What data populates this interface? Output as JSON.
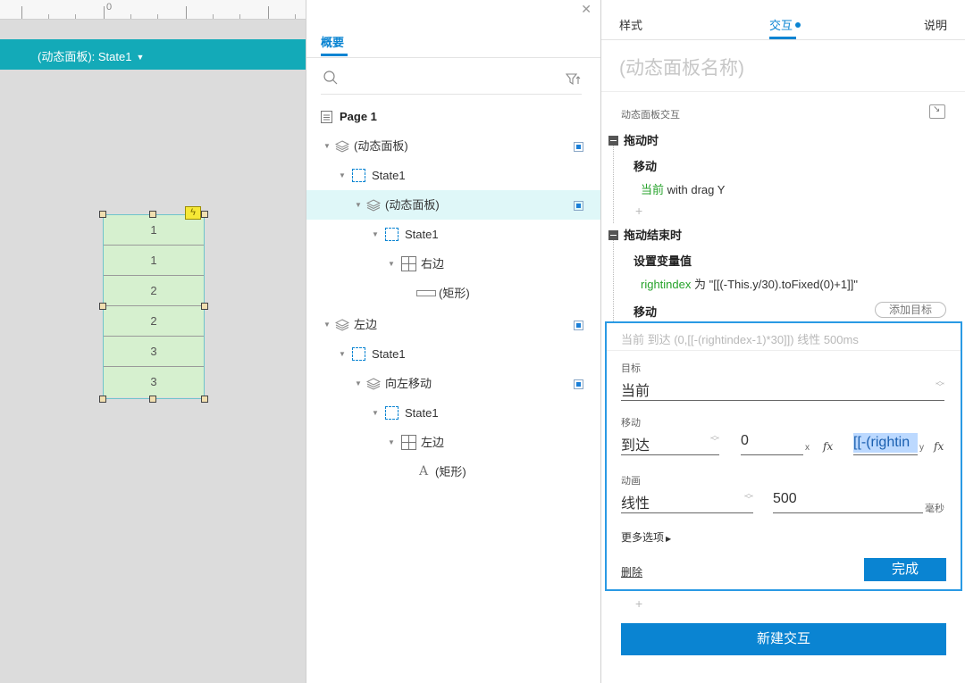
{
  "canvas": {
    "ruler_zero": "0",
    "state_bar": "(动态面板): State1",
    "rows": [
      "1",
      "1",
      "2",
      "2",
      "3",
      "3"
    ]
  },
  "outline": {
    "tab": "概要",
    "tree": [
      {
        "label": "Page 1",
        "icon": "page-icon",
        "sel": false,
        "vis": false
      },
      {
        "label": "(动态面板)",
        "icon": "layers-icon",
        "sel": false,
        "vis": true
      },
      {
        "label": "State1",
        "icon": "state-icon",
        "sel": false,
        "vis": false
      },
      {
        "label": "(动态面板)",
        "icon": "layers-icon",
        "sel": true,
        "vis": true
      },
      {
        "label": "State1",
        "icon": "state-icon",
        "sel": false,
        "vis": false
      },
      {
        "label": "右边",
        "icon": "repeater-icon",
        "sel": false,
        "vis": false
      },
      {
        "label": "(矩形)",
        "icon": "rectangle-icon",
        "sel": false,
        "vis": false
      },
      {
        "label": "左边",
        "icon": "layers-icon",
        "sel": false,
        "vis": true
      },
      {
        "label": "State1",
        "icon": "state-icon",
        "sel": false,
        "vis": false
      },
      {
        "label": "向左移动",
        "icon": "layers-icon",
        "sel": false,
        "vis": true
      },
      {
        "label": "State1",
        "icon": "state-icon",
        "sel": false,
        "vis": false
      },
      {
        "label": "左边",
        "icon": "repeater-icon",
        "sel": false,
        "vis": false
      },
      {
        "label": "(矩形)",
        "icon": "text-icon",
        "sel": false,
        "vis": false
      }
    ]
  },
  "inspector": {
    "tabs": {
      "style": "样式",
      "interaction": "交互",
      "notes": "说明"
    },
    "widget_name": "(动态面板名称)",
    "section_title": "动态面板交互",
    "event1": {
      "name": "拖动时",
      "action": "移动",
      "target_prefix": "当前",
      "target_rest": " with drag Y"
    },
    "add_plus": "+",
    "event2": {
      "name": "拖动结束时",
      "action1": "设置变量值",
      "var_name": "rightindex",
      "var_rest": " 为 \"[[(-This.y/30).toFixed(0)+1]]\"",
      "action2": "移动",
      "add_target": "添加目标"
    },
    "editor": {
      "summary": "当前 到达 (0,[[-(rightindex-1)*30]]) 线性 500ms",
      "target_label": "目标",
      "target_value": "当前",
      "move_label": "移动",
      "move_value": "到达",
      "x_value": "0",
      "x_unit": "x",
      "y_value": "[[-(rightin",
      "y_unit": "y",
      "fx": "fx",
      "anim_label": "动画",
      "anim_value": "线性",
      "duration": "500",
      "duration_unit": "毫秒",
      "more_options": "更多选项",
      "delete": "删除",
      "done": "完成"
    },
    "new_interaction": "新建交互"
  }
}
